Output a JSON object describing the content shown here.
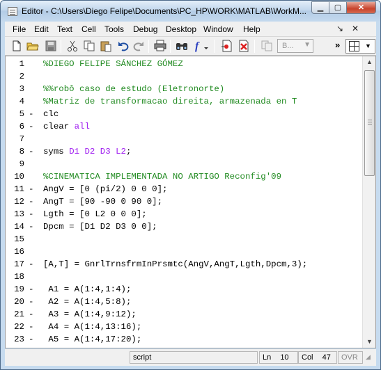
{
  "window": {
    "title": "Editor - C:\\Users\\Diego Felipe\\Documents\\PC_HP\\WORK\\MATLAB\\WorkM..."
  },
  "menu": {
    "items": [
      "File",
      "Edit",
      "Text",
      "Cell",
      "Tools",
      "Debug",
      "Desktop",
      "Window",
      "Help"
    ],
    "undock": "↘",
    "close": "✕"
  },
  "toolbar": {
    "icons": [
      "new-file-icon",
      "open-folder-icon",
      "save-icon",
      "cut-icon",
      "copy-icon",
      "paste-icon",
      "undo-icon",
      "redo-icon",
      "print-icon",
      "find-icon",
      "function-icon",
      "set-breakpoint-icon",
      "clear-breakpoint-icon",
      "stack-icon"
    ],
    "function_glyph": "f",
    "stack_combo": "B...",
    "more": "»"
  },
  "editor": {
    "lines": [
      {
        "n": "1",
        "bp": "",
        "tokens": [
          {
            "t": "%DIEGO FELIPE SÁNCHEZ GÓMEZ",
            "c": "comment"
          }
        ]
      },
      {
        "n": "2",
        "bp": "",
        "tokens": []
      },
      {
        "n": "3",
        "bp": "",
        "tokens": [
          {
            "t": "%%robô caso de estudo (Eletronorte)",
            "c": "comment"
          }
        ]
      },
      {
        "n": "4",
        "bp": "",
        "tokens": [
          {
            "t": "%Matriz de transformacao direita, armazenada en T",
            "c": "comment"
          }
        ]
      },
      {
        "n": "5",
        "bp": "-",
        "tokens": [
          {
            "t": "clc",
            "c": ""
          }
        ]
      },
      {
        "n": "6",
        "bp": "-",
        "tokens": [
          {
            "t": "clear ",
            "c": ""
          },
          {
            "t": "all",
            "c": "string"
          }
        ]
      },
      {
        "n": "7",
        "bp": "",
        "tokens": []
      },
      {
        "n": "8",
        "bp": "-",
        "tokens": [
          {
            "t": "syms ",
            "c": ""
          },
          {
            "t": "D1 D2 D3 L2",
            "c": "string"
          },
          {
            "t": ";",
            "c": ""
          }
        ]
      },
      {
        "n": "9",
        "bp": "",
        "tokens": []
      },
      {
        "n": "10",
        "bp": "",
        "tokens": [
          {
            "t": "%CINEMATICA IMPLEMENTADA NO ARTIGO Reconfig'09",
            "c": "comment"
          }
        ]
      },
      {
        "n": "11",
        "bp": "-",
        "tokens": [
          {
            "t": "AngV = [0 (pi/2) 0 0 0];",
            "c": ""
          }
        ]
      },
      {
        "n": "12",
        "bp": "-",
        "tokens": [
          {
            "t": "AngT = [90 -90 0 90 0];",
            "c": ""
          }
        ]
      },
      {
        "n": "13",
        "bp": "-",
        "tokens": [
          {
            "t": "Lgth = [0 L2 0 0 0];",
            "c": ""
          }
        ]
      },
      {
        "n": "14",
        "bp": "-",
        "tokens": [
          {
            "t": "Dpcm = [D1 D2 D3 0 0];",
            "c": ""
          }
        ]
      },
      {
        "n": "15",
        "bp": "",
        "tokens": []
      },
      {
        "n": "16",
        "bp": "",
        "tokens": []
      },
      {
        "n": "17",
        "bp": "-",
        "tokens": [
          {
            "t": "[A,T] = GnrlTrnsfrmInPrsmtc(AngV,AngT,Lgth,Dpcm,3);",
            "c": ""
          }
        ]
      },
      {
        "n": "18",
        "bp": "",
        "tokens": []
      },
      {
        "n": "19",
        "bp": "-",
        "tokens": [
          {
            "t": " A1 = A(1:4,1:4);",
            "c": ""
          }
        ]
      },
      {
        "n": "20",
        "bp": "-",
        "tokens": [
          {
            "t": " A2 = A(1:4,5:8);",
            "c": ""
          }
        ]
      },
      {
        "n": "21",
        "bp": "-",
        "tokens": [
          {
            "t": " A3 = A(1:4,9:12);",
            "c": ""
          }
        ]
      },
      {
        "n": "22",
        "bp": "-",
        "tokens": [
          {
            "t": " A4 = A(1:4,13:16);",
            "c": ""
          }
        ]
      },
      {
        "n": "23",
        "bp": "-",
        "tokens": [
          {
            "t": " A5 = A(1:4,17:20);",
            "c": ""
          }
        ]
      }
    ]
  },
  "status": {
    "mode": "script",
    "ln_label": "Ln",
    "ln_value": "10",
    "col_label": "Col",
    "col_value": "47",
    "ovr": "OVR"
  },
  "colors": {
    "comment": "#228b22",
    "string": "#a020f0",
    "keyword": "#0000ff"
  }
}
